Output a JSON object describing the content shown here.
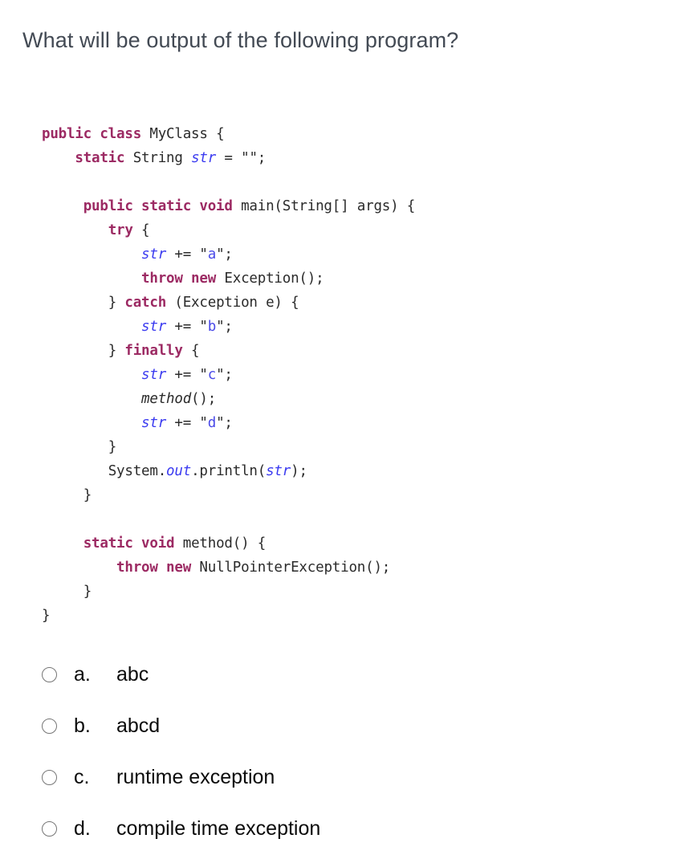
{
  "question": {
    "stem": "What will be output of the following program?"
  },
  "code": {
    "language": "java",
    "text": "public class MyClass {\n    static String str = \"\";\n\n    public static void main(String[] args) {\n        try {\n            str += \"a\";\n            throw new Exception();\n        } catch (Exception e) {\n            str += \"b\";\n        } finally {\n            str += \"c\";\n            method();\n            str += \"d\";\n        }\n        System.out.println(str);\n    }\n\n    static void method() {\n        throw new NullPointerException();\n    }\n}",
    "lines": [
      {
        "indent": 0,
        "tokens": [
          {
            "c": "k",
            "t": "public class"
          },
          {
            "c": "p",
            "t": " "
          },
          {
            "c": "t",
            "t": "MyClass"
          },
          {
            "c": "p",
            "t": " {"
          }
        ]
      },
      {
        "indent": 4,
        "tokens": [
          {
            "c": "k",
            "t": "static"
          },
          {
            "c": "p",
            "t": " "
          },
          {
            "c": "t",
            "t": "String"
          },
          {
            "c": "p",
            "t": " "
          },
          {
            "c": "v",
            "t": "str"
          },
          {
            "c": "p",
            "t": " = "
          },
          {
            "c": "sq",
            "t": "\""
          },
          {
            "c": "s",
            "t": ""
          },
          {
            "c": "sq",
            "t": "\""
          },
          {
            "c": "p",
            "t": ";"
          }
        ]
      },
      {
        "indent": 0,
        "tokens": []
      },
      {
        "indent": 5,
        "tokens": [
          {
            "c": "k",
            "t": "public static void"
          },
          {
            "c": "p",
            "t": " "
          },
          {
            "c": "t",
            "t": "main(String[] args) {"
          }
        ]
      },
      {
        "indent": 8,
        "tokens": [
          {
            "c": "k",
            "t": "try"
          },
          {
            "c": "p",
            "t": " {"
          }
        ]
      },
      {
        "indent": 12,
        "tokens": [
          {
            "c": "v",
            "t": "str"
          },
          {
            "c": "p",
            "t": " += "
          },
          {
            "c": "sq",
            "t": "\""
          },
          {
            "c": "s",
            "t": "a"
          },
          {
            "c": "sq",
            "t": "\""
          },
          {
            "c": "p",
            "t": ";"
          }
        ]
      },
      {
        "indent": 12,
        "tokens": [
          {
            "c": "k",
            "t": "throw new"
          },
          {
            "c": "p",
            "t": " "
          },
          {
            "c": "t",
            "t": "Exception();"
          }
        ]
      },
      {
        "indent": 8,
        "tokens": [
          {
            "c": "p",
            "t": "} "
          },
          {
            "c": "k",
            "t": "catch"
          },
          {
            "c": "p",
            "t": " "
          },
          {
            "c": "t",
            "t": "(Exception e) {"
          }
        ]
      },
      {
        "indent": 12,
        "tokens": [
          {
            "c": "v",
            "t": "str"
          },
          {
            "c": "p",
            "t": " += "
          },
          {
            "c": "sq",
            "t": "\""
          },
          {
            "c": "s",
            "t": "b"
          },
          {
            "c": "sq",
            "t": "\""
          },
          {
            "c": "p",
            "t": ";"
          }
        ]
      },
      {
        "indent": 8,
        "tokens": [
          {
            "c": "p",
            "t": "} "
          },
          {
            "c": "k",
            "t": "finally"
          },
          {
            "c": "p",
            "t": " {"
          }
        ]
      },
      {
        "indent": 12,
        "tokens": [
          {
            "c": "v",
            "t": "str"
          },
          {
            "c": "p",
            "t": " += "
          },
          {
            "c": "sq",
            "t": "\""
          },
          {
            "c": "s",
            "t": "c"
          },
          {
            "c": "sq",
            "t": "\""
          },
          {
            "c": "p",
            "t": ";"
          }
        ]
      },
      {
        "indent": 12,
        "tokens": [
          {
            "c": "m",
            "t": "method"
          },
          {
            "c": "p",
            "t": "();"
          }
        ]
      },
      {
        "indent": 12,
        "tokens": [
          {
            "c": "v",
            "t": "str"
          },
          {
            "c": "p",
            "t": " += "
          },
          {
            "c": "sq",
            "t": "\""
          },
          {
            "c": "s",
            "t": "d"
          },
          {
            "c": "sq",
            "t": "\""
          },
          {
            "c": "p",
            "t": ";"
          }
        ]
      },
      {
        "indent": 8,
        "tokens": [
          {
            "c": "p",
            "t": "}"
          }
        ]
      },
      {
        "indent": 8,
        "tokens": [
          {
            "c": "t",
            "t": "System."
          },
          {
            "c": "v",
            "t": "out"
          },
          {
            "c": "t",
            "t": ".println("
          },
          {
            "c": "v",
            "t": "str"
          },
          {
            "c": "t",
            "t": ");"
          }
        ]
      },
      {
        "indent": 5,
        "tokens": [
          {
            "c": "p",
            "t": "}"
          }
        ]
      },
      {
        "indent": 0,
        "tokens": []
      },
      {
        "indent": 5,
        "tokens": [
          {
            "c": "k",
            "t": "static void"
          },
          {
            "c": "p",
            "t": " "
          },
          {
            "c": "t",
            "t": "method() {"
          }
        ]
      },
      {
        "indent": 9,
        "tokens": [
          {
            "c": "k",
            "t": "throw new"
          },
          {
            "c": "p",
            "t": " "
          },
          {
            "c": "t",
            "t": "NullPointerException();"
          }
        ]
      },
      {
        "indent": 5,
        "tokens": [
          {
            "c": "p",
            "t": "}"
          }
        ]
      },
      {
        "indent": 0,
        "tokens": [
          {
            "c": "p",
            "t": "}"
          }
        ]
      }
    ]
  },
  "options": [
    {
      "letter": "a.",
      "text": "abc",
      "selected": false
    },
    {
      "letter": "b.",
      "text": "abcd",
      "selected": false
    },
    {
      "letter": "c.",
      "text": "runtime exception",
      "selected": false
    },
    {
      "letter": "d.",
      "text": "compile time exception",
      "selected": false
    }
  ],
  "colors": {
    "page_background": "#ffffff",
    "stem_text": "#434a54",
    "option_text": "#0b0b0b",
    "radio_border": "#767676",
    "code_keyword": "#9c2a63",
    "code_variable": "#3b3bf0",
    "code_string": "#4a4ae8",
    "code_plain": "#2b2b2b"
  }
}
